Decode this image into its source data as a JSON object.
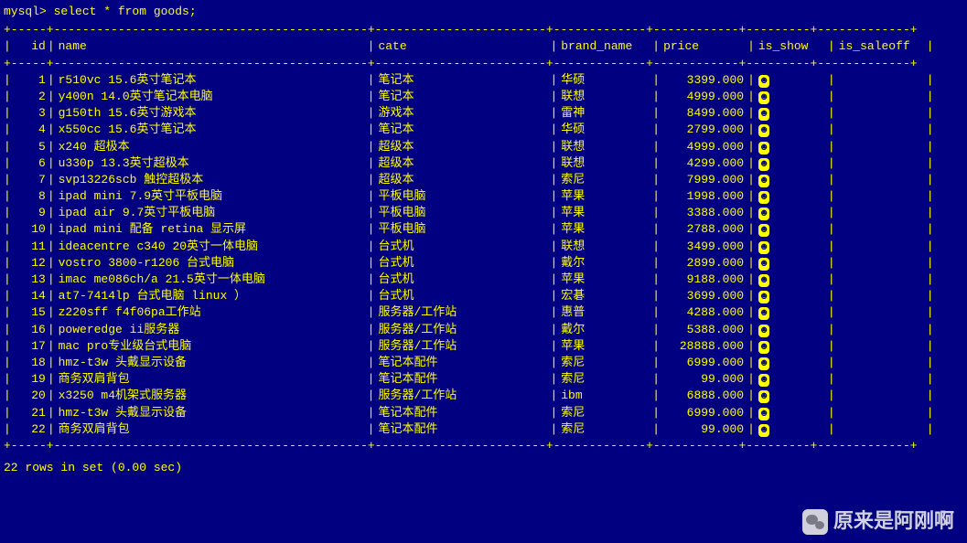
{
  "prompt": "mysql> select * from goods;",
  "headers": {
    "id": "id",
    "name": "name",
    "cate": "cate",
    "brand": "brand_name",
    "price": "price",
    "show": "is_show",
    "off": "is_saleoff"
  },
  "rows": [
    {
      "id": "1",
      "name": "r510vc 15.6英寸笔记本",
      "cate": "笔记本",
      "brand": "华硕",
      "price": "3399.000",
      "show": "☺"
    },
    {
      "id": "2",
      "name": "y400n 14.0英寸笔记本电脑",
      "cate": "笔记本",
      "brand": "联想",
      "price": "4999.000",
      "show": "☺"
    },
    {
      "id": "3",
      "name": "g150th 15.6英寸游戏本",
      "cate": "游戏本",
      "brand": "雷神",
      "price": "8499.000",
      "show": "☺"
    },
    {
      "id": "4",
      "name": "x550cc 15.6英寸笔记本",
      "cate": "笔记本",
      "brand": "华硕",
      "price": "2799.000",
      "show": "☺"
    },
    {
      "id": "5",
      "name": "x240 超极本",
      "cate": "超级本",
      "brand": "联想",
      "price": "4999.000",
      "show": "☺"
    },
    {
      "id": "6",
      "name": "u330p 13.3英寸超极本",
      "cate": "超级本",
      "brand": "联想",
      "price": "4299.000",
      "show": "☺"
    },
    {
      "id": "7",
      "name": "svp13226scb 触控超极本",
      "cate": "超级本",
      "brand": "索尼",
      "price": "7999.000",
      "show": "☺"
    },
    {
      "id": "8",
      "name": "ipad mini 7.9英寸平板电脑",
      "cate": "平板电脑",
      "brand": "苹果",
      "price": "1998.000",
      "show": "☺"
    },
    {
      "id": "9",
      "name": "ipad air 9.7英寸平板电脑",
      "cate": "平板电脑",
      "brand": "苹果",
      "price": "3388.000",
      "show": "☺"
    },
    {
      "id": "10",
      "name": "ipad mini 配备 retina 显示屏",
      "cate": "平板电脑",
      "brand": "苹果",
      "price": "2788.000",
      "show": "☺"
    },
    {
      "id": "11",
      "name": "ideacentre c340 20英寸一体电脑",
      "cate": "台式机",
      "brand": "联想",
      "price": "3499.000",
      "show": "☺"
    },
    {
      "id": "12",
      "name": "vostro 3800-r1206 台式电脑",
      "cate": "台式机",
      "brand": "戴尔",
      "price": "2899.000",
      "show": "☺"
    },
    {
      "id": "13",
      "name": "imac me086ch/a 21.5英寸一体电脑",
      "cate": "台式机",
      "brand": "苹果",
      "price": "9188.000",
      "show": "☺"
    },
    {
      "id": "14",
      "name": "at7-7414lp 台式电脑 linux ）",
      "cate": "台式机",
      "brand": "宏碁",
      "price": "3699.000",
      "show": "☺"
    },
    {
      "id": "15",
      "name": "z220sff f4f06pa工作站",
      "cate": "服务器/工作站",
      "brand": "惠普",
      "price": "4288.000",
      "show": "☺"
    },
    {
      "id": "16",
      "name": "poweredge ii服务器",
      "cate": "服务器/工作站",
      "brand": "戴尔",
      "price": "5388.000",
      "show": "☺"
    },
    {
      "id": "17",
      "name": "mac pro专业级台式电脑",
      "cate": "服务器/工作站",
      "brand": "苹果",
      "price": "28888.000",
      "show": "☺"
    },
    {
      "id": "18",
      "name": "hmz-t3w 头戴显示设备",
      "cate": "笔记本配件",
      "brand": "索尼",
      "price": "6999.000",
      "show": "☺"
    },
    {
      "id": "19",
      "name": "商务双肩背包",
      "cate": "笔记本配件",
      "brand": "索尼",
      "price": "99.000",
      "show": "☺"
    },
    {
      "id": "20",
      "name": "x3250 m4机架式服务器",
      "cate": "服务器/工作站",
      "brand": "ibm",
      "price": "6888.000",
      "show": "☺"
    },
    {
      "id": "21",
      "name": "hmz-t3w 头戴显示设备",
      "cate": "笔记本配件",
      "brand": "索尼",
      "price": "6999.000",
      "show": "☺"
    },
    {
      "id": "22",
      "name": "商务双肩背包",
      "cate": "笔记本配件",
      "brand": "索尼",
      "price": "99.000",
      "show": "☺"
    }
  ],
  "summary": "22 rows in set (0.00 sec)",
  "watermark": "原来是阿刚啊",
  "chart_data": {
    "type": "table",
    "columns": [
      "id",
      "name",
      "cate",
      "brand_name",
      "price",
      "is_show",
      "is_saleoff"
    ],
    "title": "select * from goods;"
  }
}
